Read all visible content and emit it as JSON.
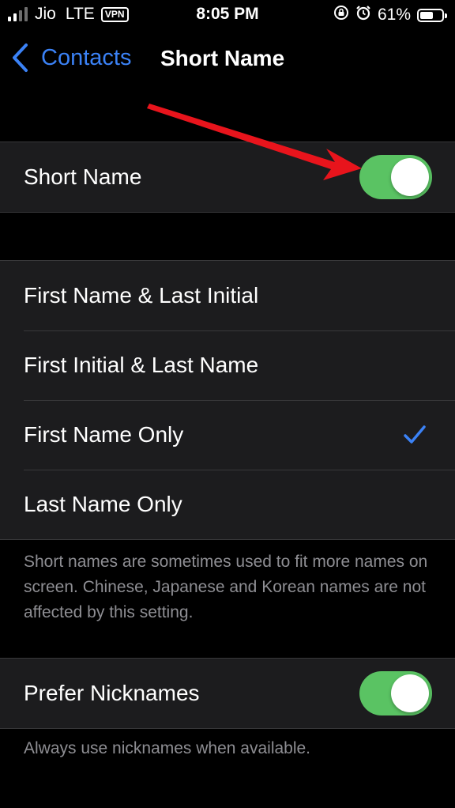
{
  "status_bar": {
    "carrier": "Jio",
    "network": "LTE",
    "vpn": "VPN",
    "time": "8:05 PM",
    "battery": "61%",
    "battery_level": 0.61,
    "signal_bars": 4,
    "signal_active": 2,
    "icons": [
      "orientation-lock-icon",
      "alarm-icon",
      "battery-icon"
    ]
  },
  "nav": {
    "back_label": "Contacts",
    "title": "Short Name"
  },
  "short_name_group": {
    "label": "Short Name",
    "enabled": true
  },
  "format_options": {
    "items": [
      {
        "label": "First Name & Last Initial",
        "selected": false
      },
      {
        "label": "First Initial & Last Name",
        "selected": false
      },
      {
        "label": "First Name Only",
        "selected": true
      },
      {
        "label": "Last Name Only",
        "selected": false
      }
    ],
    "footer": "Short names are sometimes used to fit more names on screen. Chinese, Japanese and Korean names are not affected by this setting."
  },
  "nicknames_group": {
    "label": "Prefer Nicknames",
    "enabled": true,
    "footer": "Always use nicknames when available."
  },
  "colors": {
    "accent": "#3b82f6",
    "toggle_on": "#5ac363",
    "annotation_arrow": "#e8141c"
  }
}
